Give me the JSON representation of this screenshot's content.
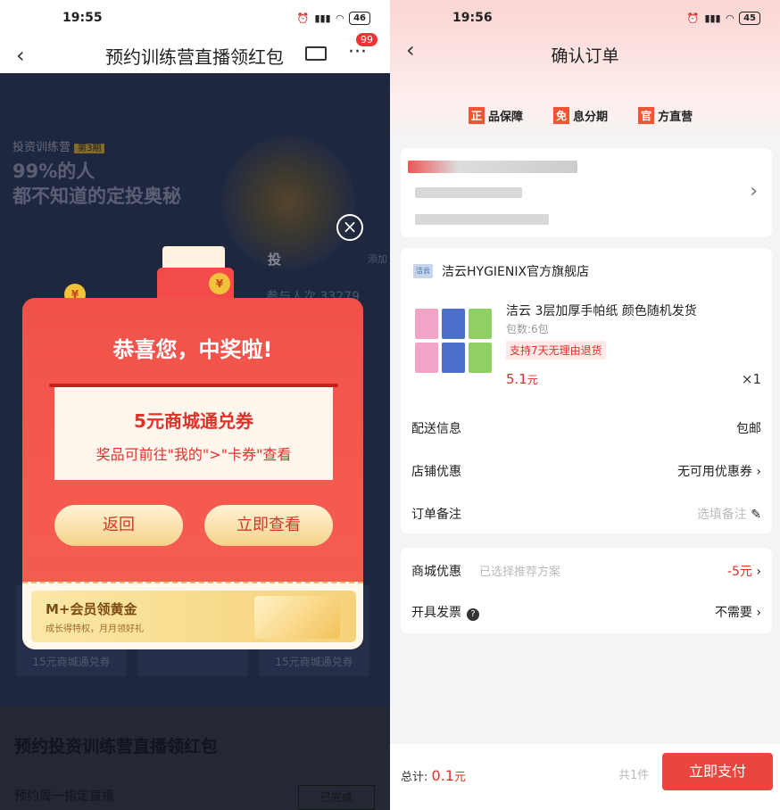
{
  "left": {
    "status": {
      "time": "19:55",
      "battery": "46"
    },
    "nav": {
      "title": "预约训练营直播领红包",
      "badge": "99"
    },
    "hero": {
      "tag": "投资训练营",
      "issue": "第3期",
      "line1": "99%的人",
      "line2": "都不知道的定投奥秘",
      "invest": "投",
      "participants": "参与人次 33279",
      "add_label": "添加"
    },
    "tiles": [
      "15元商城通兑券",
      "",
      "15元商城通兑券"
    ],
    "section": {
      "title": "预约投资训练营直播领红包",
      "sub": "预约周一指定直播",
      "btn": "已完成"
    },
    "modal": {
      "title": "恭喜您，中奖啦!",
      "prize_name": "5元商城通兑券",
      "prize_desc": "奖品可前往\"我的\">\"卡券\"查看",
      "back": "返回",
      "view": "立即查看",
      "gold_title": "M+会员领黄金",
      "gold_sub": "成长得特权，月月领好礼"
    }
  },
  "right": {
    "status": {
      "time": "19:56",
      "battery": "45"
    },
    "nav": {
      "title": "确认订单"
    },
    "badges": [
      {
        "icon": "正",
        "label": "品保障"
      },
      {
        "icon": "免",
        "label": "息分期"
      },
      {
        "icon": "官",
        "label": "方直营"
      }
    ],
    "shop": {
      "logo": "洁云",
      "name": "洁云HYGIENIX官方旗舰店"
    },
    "product": {
      "name": "洁云 3层加厚手帕纸 颜色随机发货",
      "spec": "包数:6包",
      "return_policy": "支持7天无理由退货",
      "price": "5.1",
      "unit": "元",
      "qty": "×1"
    },
    "rows": {
      "delivery_label": "配送信息",
      "delivery_value": "包邮",
      "store_label": "店铺优惠",
      "store_value": "无可用优惠券",
      "note_label": "订单备注",
      "note_value": "选填备注",
      "mall_label": "商城优惠",
      "mall_hint": "已选择推荐方案",
      "mall_value": "-5元",
      "invoice_label": "开具发票",
      "invoice_value": "不需要"
    },
    "bottom": {
      "total_label": "总计:",
      "total_value": "0.1",
      "total_unit": "元",
      "count": "共1件",
      "pay": "立即支付"
    }
  },
  "colors": {
    "accent": "#e8463f",
    "modal_red": "#f0524a"
  }
}
